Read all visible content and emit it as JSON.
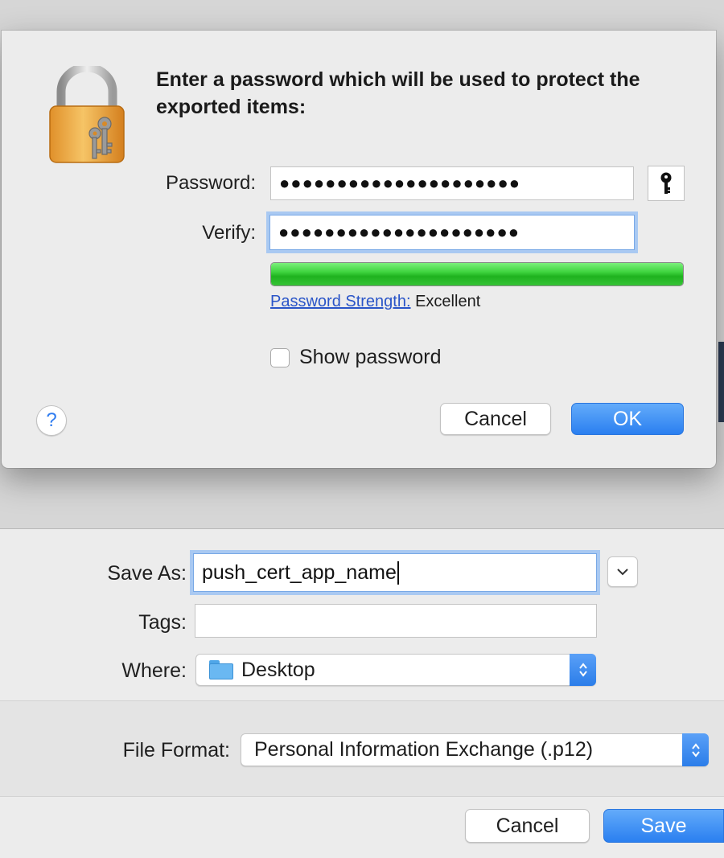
{
  "password_sheet": {
    "title": "Enter a password which will be used to protect the exported items:",
    "password_label": "Password:",
    "password_value": "●●●●●●●●●●●●●●●●●●●●●",
    "verify_label": "Verify:",
    "verify_value": "●●●●●●●●●●●●●●●●●●●●●",
    "key_icon": "key-icon",
    "strength_link": "Password Strength:",
    "strength_value": "Excellent",
    "strength_level": 1.0,
    "strength_color": "#2fc52f",
    "show_password_label": "Show password",
    "show_password_checked": false,
    "help_icon": "help-icon",
    "help_glyph": "?",
    "cancel_label": "Cancel",
    "ok_label": "OK"
  },
  "save_panel": {
    "save_as_label": "Save As:",
    "save_as_value": "push_cert_app_name",
    "tags_label": "Tags:",
    "tags_value": "",
    "where_label": "Where:",
    "where_value": "Desktop",
    "file_format_label": "File Format:",
    "file_format_value": "Personal Information Exchange (.p12)",
    "cancel_label": "Cancel",
    "save_label": "Save"
  },
  "colors": {
    "accent": "#2a7ff0",
    "link": "#2a55c8",
    "focus_ring": "#a9c9f2"
  }
}
